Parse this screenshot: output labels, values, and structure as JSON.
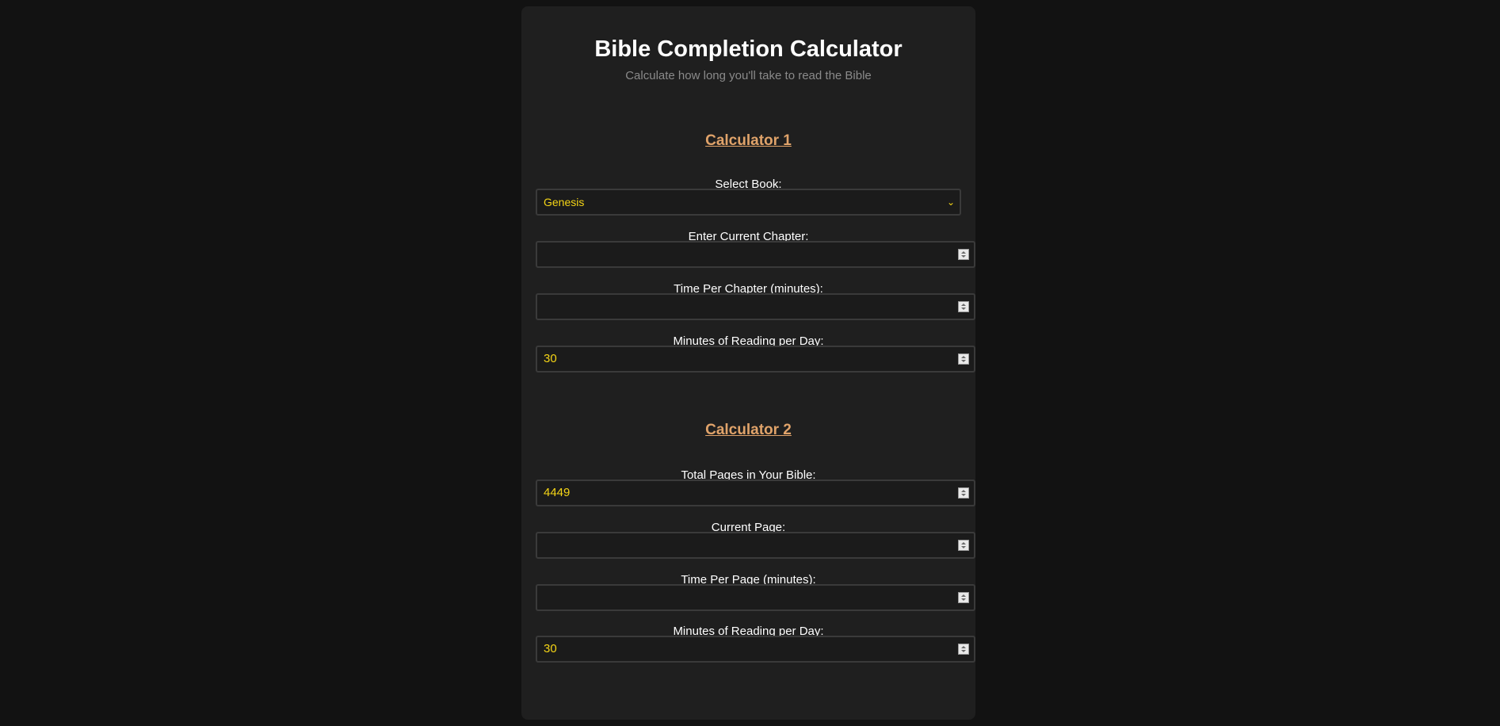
{
  "header": {
    "title": "Bible Completion Calculator",
    "subtitle": "Calculate how long you'll take to read the Bible"
  },
  "calculator1": {
    "heading": "Calculator 1",
    "book_label": "Select Book:",
    "book_value": "Genesis",
    "chapter_label": "Enter Current Chapter:",
    "chapter_value": "",
    "time_per_chapter_label": "Time Per Chapter (minutes):",
    "time_per_chapter_value": "",
    "minutes_per_day_label": "Minutes of Reading per Day:",
    "minutes_per_day_value": "30"
  },
  "calculator2": {
    "heading": "Calculator 2",
    "total_pages_label": "Total Pages in Your Bible:",
    "total_pages_value": "4449",
    "current_page_label": "Current Page:",
    "current_page_value": "",
    "time_per_page_label": "Time Per Page (minutes):",
    "time_per_page_value": "",
    "minutes_per_day_label": "Minutes of Reading per Day:",
    "minutes_per_day_value": "30"
  },
  "colors": {
    "page_background": "#121212",
    "card_background": "#1f1f1f",
    "heading_accent": "#e0a36a",
    "input_text": "#f5d516"
  },
  "icons": {
    "select_chevron": "chevron-down-icon",
    "number_spinner": "spinner-icon"
  }
}
